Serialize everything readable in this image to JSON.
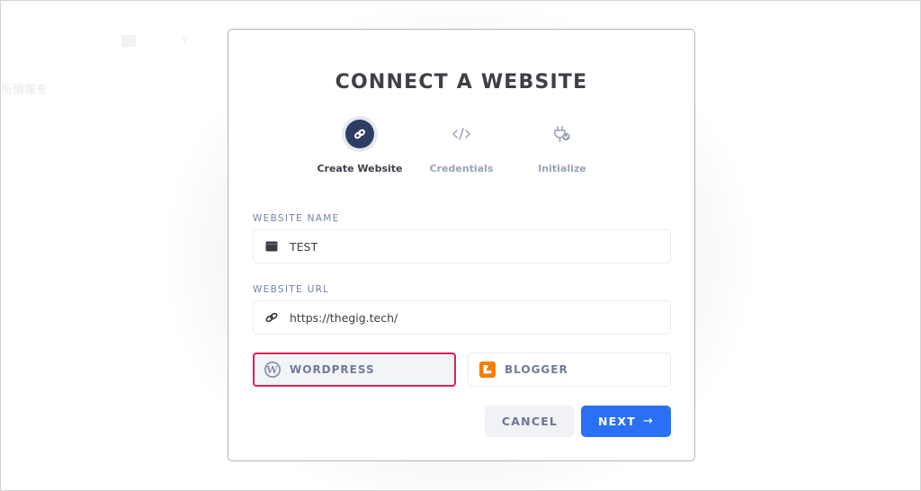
{
  "background": {
    "jp_text": "所情報を",
    "chevron": "∨"
  },
  "modal": {
    "title": "CONNECT A WEBSITE",
    "steps": [
      {
        "label": "Create Website",
        "icon": "link-icon",
        "active": true
      },
      {
        "label": "Credentials",
        "icon": "code-icon",
        "active": false
      },
      {
        "label": "Initialize",
        "icon": "plug-check-icon",
        "active": false
      }
    ],
    "fields": {
      "website_name": {
        "label": "WEBSITE NAME",
        "value": "TEST",
        "icon": "browser-window-icon"
      },
      "website_url": {
        "label": "WEBSITE URL",
        "value": "https://thegig.tech/",
        "icon": "link-icon"
      }
    },
    "platforms": [
      {
        "label": "WORDPRESS",
        "icon": "wordpress-icon",
        "selected": true
      },
      {
        "label": "BLOGGER",
        "icon": "blogger-icon",
        "selected": false
      }
    ],
    "buttons": {
      "cancel": "CANCEL",
      "next": "NEXT",
      "next_arrow": "→"
    }
  },
  "colors": {
    "accent": "#2b6ff5",
    "selected_border": "#e0204f",
    "step_active": "#2e3d64",
    "blogger_orange": "#f57d00"
  }
}
